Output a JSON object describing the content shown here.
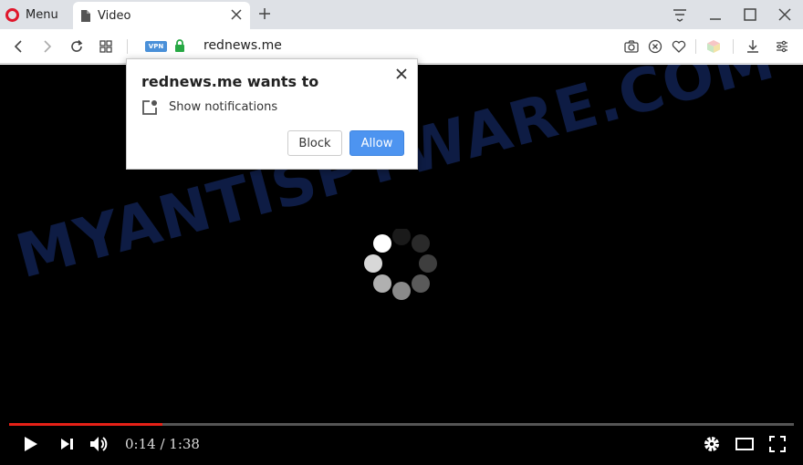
{
  "browser": {
    "menu_label": "Menu",
    "tab_title": "Video",
    "vpn_badge": "VPN",
    "url": "rednews.me",
    "colors": {
      "accent": "#e0162b",
      "vpn": "#4a90d9",
      "lock": "#27a844"
    }
  },
  "popup": {
    "title": "rednews.me wants to",
    "permission": "Show notifications",
    "block_label": "Block",
    "allow_label": "Allow",
    "colors": {
      "allow": "#4d94f0"
    }
  },
  "video": {
    "watermark": "MYANTISPYWARE.COM",
    "current_time": "0:14",
    "separator": " / ",
    "duration": "1:38",
    "progress": 0.195,
    "colors": {
      "progress": "#e62117"
    }
  },
  "icons": {
    "tab": [
      "opera-logo-icon",
      "document-icon",
      "close-icon",
      "plus-icon"
    ],
    "window": [
      "tab-menu-icon",
      "minimize-icon",
      "maximize-icon",
      "close-window-icon"
    ],
    "nav": [
      "back-icon",
      "forward-icon",
      "reload-icon",
      "speed-dial-icon"
    ],
    "toolbar": [
      "camera-icon",
      "adblock-icon",
      "heart-icon",
      "cube-icon",
      "download-icon",
      "settings-sliders-icon"
    ],
    "player": [
      "play-icon",
      "next-icon",
      "volume-icon",
      "gear-icon",
      "theater-icon",
      "fullscreen-icon"
    ]
  }
}
